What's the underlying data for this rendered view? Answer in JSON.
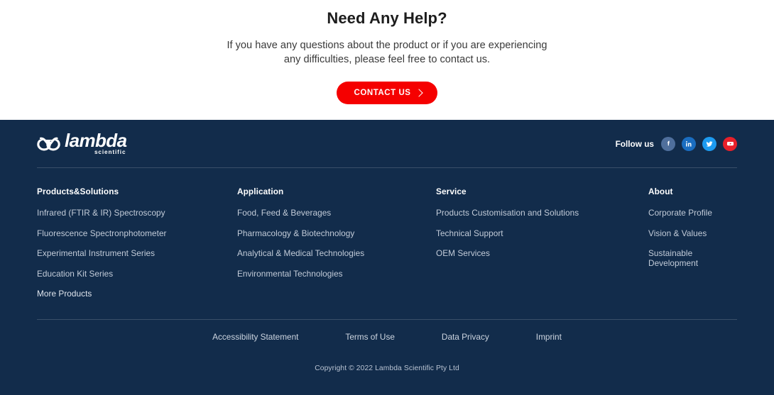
{
  "help": {
    "title": "Need Any Help?",
    "description": "If you have any questions about the product or if you are experiencing any difficulties, please feel free to contact us.",
    "cta_label": "CONTACT US",
    "cta_icon": "chevron-right-icon",
    "cta_color": "#f50000"
  },
  "footer": {
    "background_color": "#122c4b",
    "logo": {
      "mark_icon": "lambda-infinity-logo-icon",
      "word": "lambda",
      "subtitle": "scientific"
    },
    "follow": {
      "label": "Follow us",
      "socials": [
        {
          "name": "facebook-icon",
          "glyph": "f",
          "color": "#4f6f9c"
        },
        {
          "name": "linkedin-icon",
          "glyph": "in",
          "color": "#1a6dc0"
        },
        {
          "name": "twitter-icon",
          "glyph": "bird",
          "color": "#1d9bf0"
        },
        {
          "name": "youtube-icon",
          "glyph": "play",
          "color": "#e8202a"
        }
      ]
    },
    "columns": [
      {
        "heading": "Products&Solutions",
        "links": [
          "Infrared (FTIR & IR) Spectroscopy",
          "Fluorescence Spectronphotometer",
          "Experimental Instrument Series",
          "Education Kit Series",
          "More Products"
        ]
      },
      {
        "heading": "Application",
        "links": [
          "Food, Feed & Beverages",
          "Pharmacology & Biotechnology",
          "Analytical & Medical Technologies",
          "Environmental Technologies"
        ]
      },
      {
        "heading": "Service",
        "links": [
          "Products Customisation and Solutions",
          "Technical Support",
          "OEM Services"
        ]
      },
      {
        "heading": "About",
        "links": [
          "Corporate Profile",
          "Vision & Values",
          "Sustainable Development"
        ]
      }
    ],
    "legal_links": [
      "Accessibility Statement",
      "Terms of Use",
      "Data Privacy",
      "Imprint"
    ],
    "copyright": "Copyright © 2022 Lambda Scientific Pty Ltd"
  }
}
